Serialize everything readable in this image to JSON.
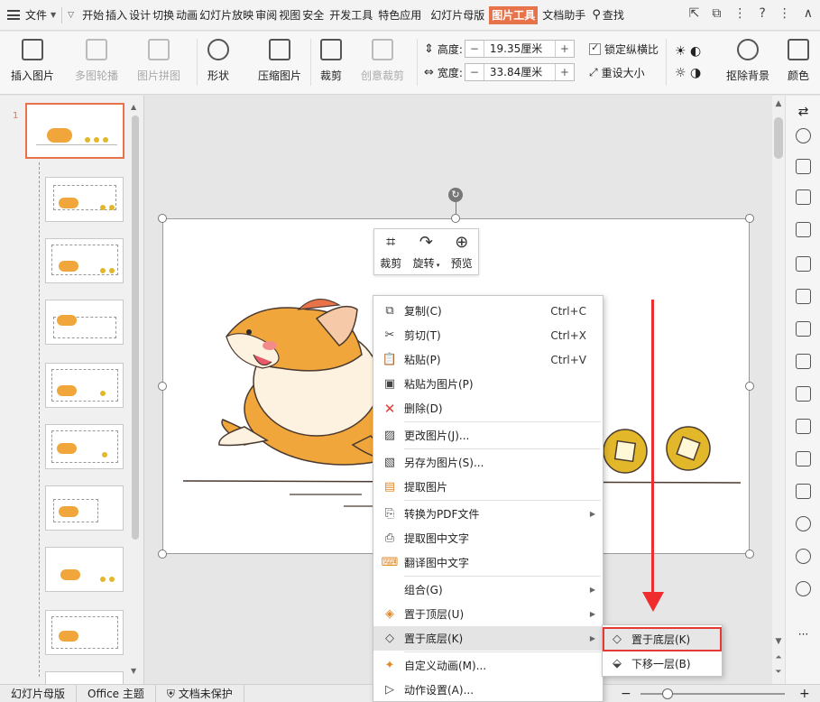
{
  "menubar": {
    "file_label": "文件",
    "tabs": [
      "开始",
      "插入",
      "设计",
      "切换",
      "动画",
      "幻灯片放映",
      "审阅",
      "视图",
      "安全",
      "开发工具",
      "特色应用",
      "幻灯片母版",
      "图片工具",
      "文档助手"
    ],
    "active_tab": "图片工具",
    "search_label": "查找",
    "accent_color": "#e8734a"
  },
  "toolbar": {
    "insert_picture": "插入图片",
    "multi_contour": "多图轮播",
    "picture_collage": "图片拼图",
    "shape": "形状",
    "compress_picture": "压缩图片",
    "crop": "裁剪",
    "creative_crop": "创意裁剪",
    "height_label": "高度:",
    "height_value": "19.35厘米",
    "width_label": "宽度:",
    "width_value": "33.84厘米",
    "lock_ratio": "锁定纵横比",
    "reset_size": "重设大小",
    "remove_bg": "抠除背景",
    "color": "颜色"
  },
  "thumbnails": {
    "selected_number": "1"
  },
  "minibar": {
    "crop": "裁剪",
    "rotate": "旋转",
    "preview": "预览"
  },
  "context_menu": {
    "copy": "复制(C)",
    "copy_short": "Ctrl+C",
    "cut": "剪切(T)",
    "cut_short": "Ctrl+X",
    "paste": "粘贴(P)",
    "paste_short": "Ctrl+V",
    "paste_as_picture": "粘贴为图片(P)",
    "delete": "删除(D)",
    "change_picture": "更改图片(J)...",
    "save_as_picture": "另存为图片(S)...",
    "extract_picture": "提取图片",
    "convert_pdf": "转换为PDF文件",
    "extract_text": "提取图中文字",
    "translate_text": "翻译图中文字",
    "group": "组合(G)",
    "bring_to_front": "置于顶层(U)",
    "send_to_back": "置于底层(K)",
    "custom_animation": "自定义动画(M)...",
    "action_settings": "动作设置(A)..."
  },
  "submenu": {
    "send_to_back": "置于底层(K)",
    "send_backward": "下移一层(B)"
  },
  "statusbar": {
    "master": "幻灯片母版",
    "theme": "Office 主题",
    "protection": "文档未保护",
    "zoom_minus": "−",
    "zoom_plus": "+"
  },
  "colors": {
    "highlight_red": "#e53935",
    "arrow_red": "#f02d2d",
    "dog_orange": "#f0a63a",
    "coin_gold": "#e2b82a"
  }
}
